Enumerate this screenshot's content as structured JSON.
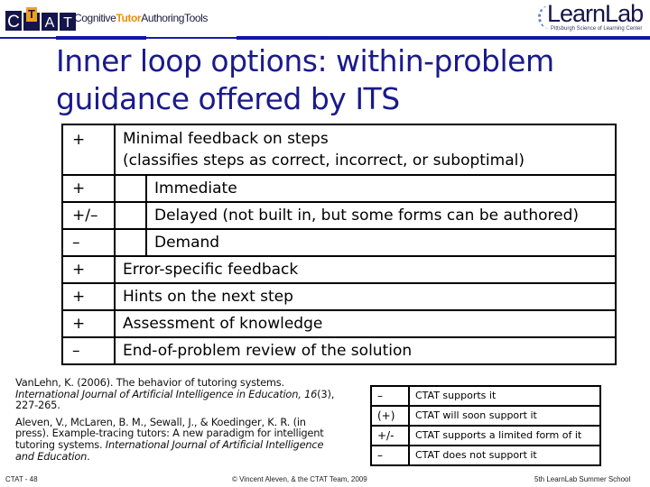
{
  "header": {
    "ctat_logo_letters": [
      "C",
      "T",
      "A",
      "T"
    ],
    "ctat_text_prefix": "Cognitive",
    "ctat_text_highlight": "Tutor",
    "ctat_text_suffix": "AuthoringTools",
    "learnlab_name": "LearnLab",
    "learnlab_subtitle": "Pittsburgh Science of Learning Center",
    "accent_color": "#1a1a8c",
    "bar_color": "#0f15a8",
    "tutor_color": "#e8900c"
  },
  "slide": {
    "title_line1": "Inner loop options: within-problem",
    "title_line2": "guidance offered by ITS"
  },
  "main_table": {
    "rows": [
      {
        "symbol": "+",
        "text": "Minimal feedback on steps",
        "text2": "(classifies steps as correct, incorrect, or suboptimal)",
        "indent": false
      },
      {
        "symbol": "+",
        "text": "Immediate",
        "indent": true
      },
      {
        "symbol": "+/–",
        "text": "Delayed (not built in, but some forms can be authored)",
        "indent": true
      },
      {
        "symbol": "–",
        "text": "Demand",
        "indent": true
      },
      {
        "symbol": "+",
        "text": "Error-specific feedback",
        "indent": false
      },
      {
        "symbol": "+",
        "text": "Hints on the next step",
        "indent": false
      },
      {
        "symbol": "+",
        "text": "Assessment of knowledge",
        "indent": false
      },
      {
        "symbol": "–",
        "text": "End-of-problem review of the solution",
        "indent": false
      }
    ]
  },
  "references": [
    {
      "authors": "VanLehn, K. (2006). The behavior of tutoring systems. ",
      "journal": "International Journal of Artificial Intelligence in Education",
      "sep": ", ",
      "volume": "16",
      "rest": "(3), 227-265."
    },
    {
      "authors": "Aleven, V., McLaren, B. M., Sewall, J., & Koedinger, K. R. (in press). Example-tracing tutors: A new paradigm for intelligent tutoring systems. ",
      "journal": "International Journal of Artificial Intelligence and Education",
      "rest": "."
    }
  ],
  "legend": {
    "rows": [
      {
        "symbol": "–",
        "text": "CTAT supports it"
      },
      {
        "symbol": "(+)",
        "text": "CTAT will soon support it"
      },
      {
        "symbol": "+/-",
        "text": "CTAT supports a limited form of it"
      },
      {
        "symbol": "–",
        "text": "CTAT does not support it"
      }
    ]
  },
  "footer": {
    "slide_number": "CTAT - 48",
    "copyright": "© Vincent Aleven, & the CTAT Team, 2009",
    "event": "5th LearnLab Summer School"
  }
}
